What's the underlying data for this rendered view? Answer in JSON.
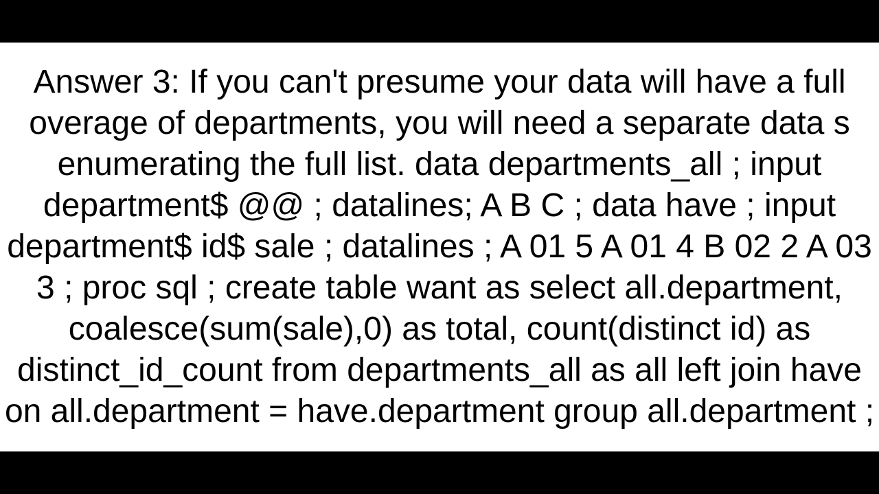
{
  "answer": {
    "label": "Answer 3:",
    "text": "Answer 3: If you can't presume your data will have a full overage of departments, you will need a separate data s enumerating the full list. data departments_all ;   input department$ @@ ; datalines; A B C ; data have ; input department$ id$ sale ; datalines ; A   01  5 A   01  4 B 02  2 A   03  3 ; proc sql ;   create table want as   select all.department, coalesce(sum(sale),0) as total, count(distinct id) as distinct_id_count   from departments_all as all   left join have on all.department = have.department   group all.department    ;"
  }
}
